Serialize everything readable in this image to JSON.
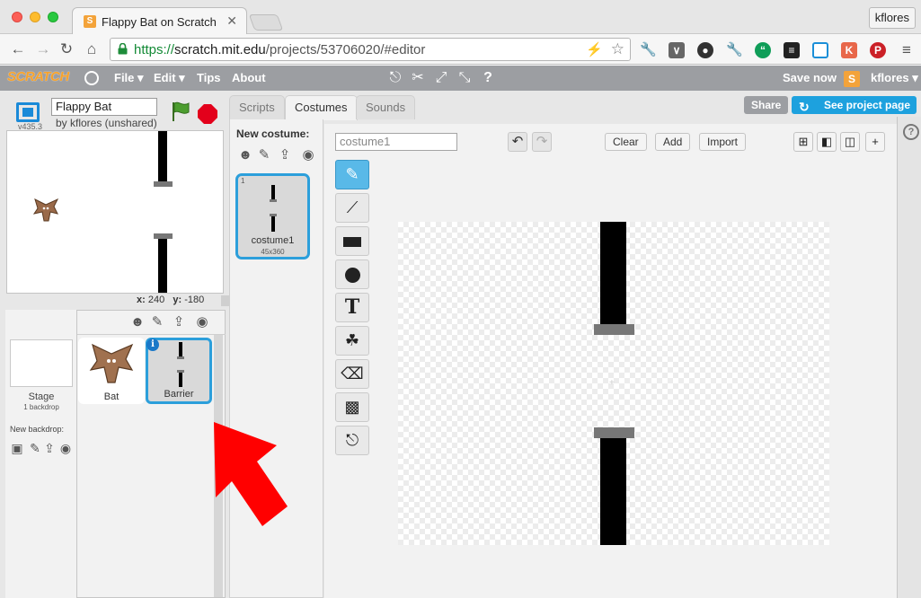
{
  "browser": {
    "tab_title": "Flappy Bat on Scratch",
    "tab_close": "✕",
    "user_button": "kflores",
    "url_secure": "https://",
    "url_host": "scratch.mit.edu",
    "url_path": "/projects/53706020/#editor"
  },
  "menubar": {
    "logo": "SCRATCH",
    "file": "File ▾",
    "edit": "Edit ▾",
    "tips": "Tips",
    "about": "About",
    "save_now": "Save now",
    "user": "kflores ▾"
  },
  "stage_panel": {
    "version": "v435.3",
    "project_title": "Flappy Bat",
    "by_line": "by kflores (unshared)",
    "x_label": "x:",
    "x_value": "240",
    "y_label": "y:",
    "y_value": "-180"
  },
  "sprites": {
    "stage_label": "Stage",
    "stage_sub": "1 backdrop",
    "new_backdrop_label": "New backdrop:",
    "items": [
      {
        "name": "Bat",
        "selected": false
      },
      {
        "name": "Barrier",
        "selected": true
      }
    ],
    "info_badge": "i"
  },
  "tabs": {
    "scripts": "Scripts",
    "costumes": "Costumes",
    "sounds": "Sounds",
    "active": "Costumes"
  },
  "header_buttons": {
    "share": "Share",
    "see_project_page": "See project page"
  },
  "costumes": {
    "new_costume_label": "New costume:",
    "items": [
      {
        "index": "1",
        "name": "costume1",
        "size": "45x360"
      }
    ]
  },
  "paint_editor": {
    "costume_name_value": "costume1",
    "clear": "Clear",
    "add": "Add",
    "import": "Import",
    "tools": [
      "brush",
      "line",
      "rectangle",
      "ellipse",
      "text",
      "fill",
      "eraser",
      "select",
      "stamp"
    ],
    "active_tool": "brush",
    "text_tool_glyph": "T"
  },
  "colors": {
    "accent_blue": "#2c9fdb",
    "menubar_gray": "#9c9ea2",
    "scratch_orange": "#f7a22b",
    "arrow_red": "#ff0000",
    "flag_green": "#3a8f2a",
    "stop_red": "#e3001b"
  }
}
